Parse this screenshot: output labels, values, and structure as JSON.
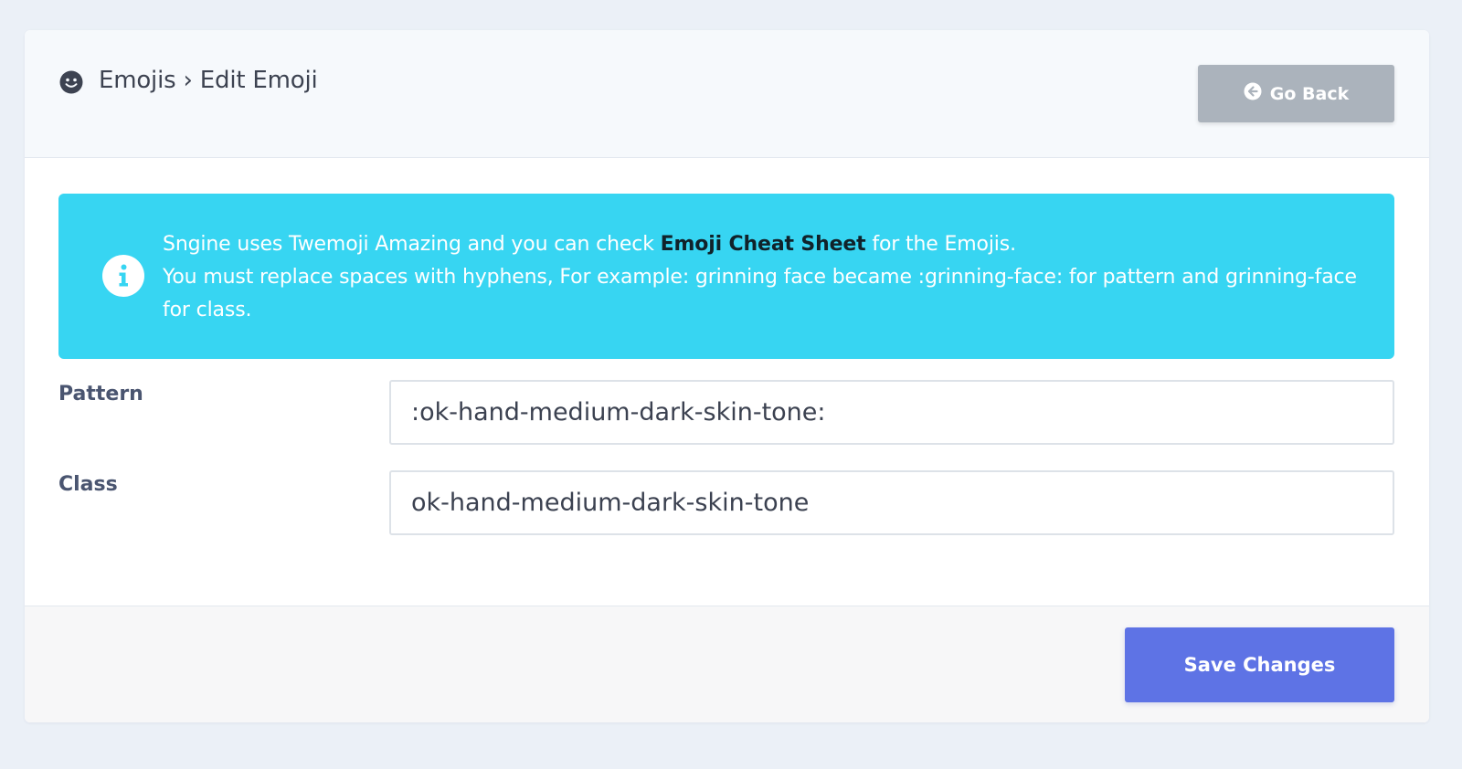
{
  "header": {
    "icon": "smile-icon",
    "title": "Emojis › Edit Emoji",
    "back_button": {
      "icon": "arrow-circle-left-icon",
      "label": "Go Back"
    }
  },
  "alert": {
    "icon": "info-circle-icon",
    "line1_before": "Sngine uses Twemoji Amazing and you can check ",
    "link_label": "Emoji Cheat Sheet",
    "line1_after": " for the Emojis.",
    "line2": "You must replace spaces with hyphens, For example: grinning face became :grinning-face: for pattern and grinning-face for class."
  },
  "form": {
    "pattern": {
      "label": "Pattern",
      "value": ":ok-hand-medium-dark-skin-tone:"
    },
    "class": {
      "label": "Class",
      "value": "ok-hand-medium-dark-skin-tone"
    }
  },
  "footer": {
    "save_label": "Save Changes"
  },
  "colors": {
    "page_bg": "#ebf0f7",
    "alert_bg": "#37d5f2",
    "save_button": "#5e73e5",
    "back_button": "#abb3bc"
  }
}
